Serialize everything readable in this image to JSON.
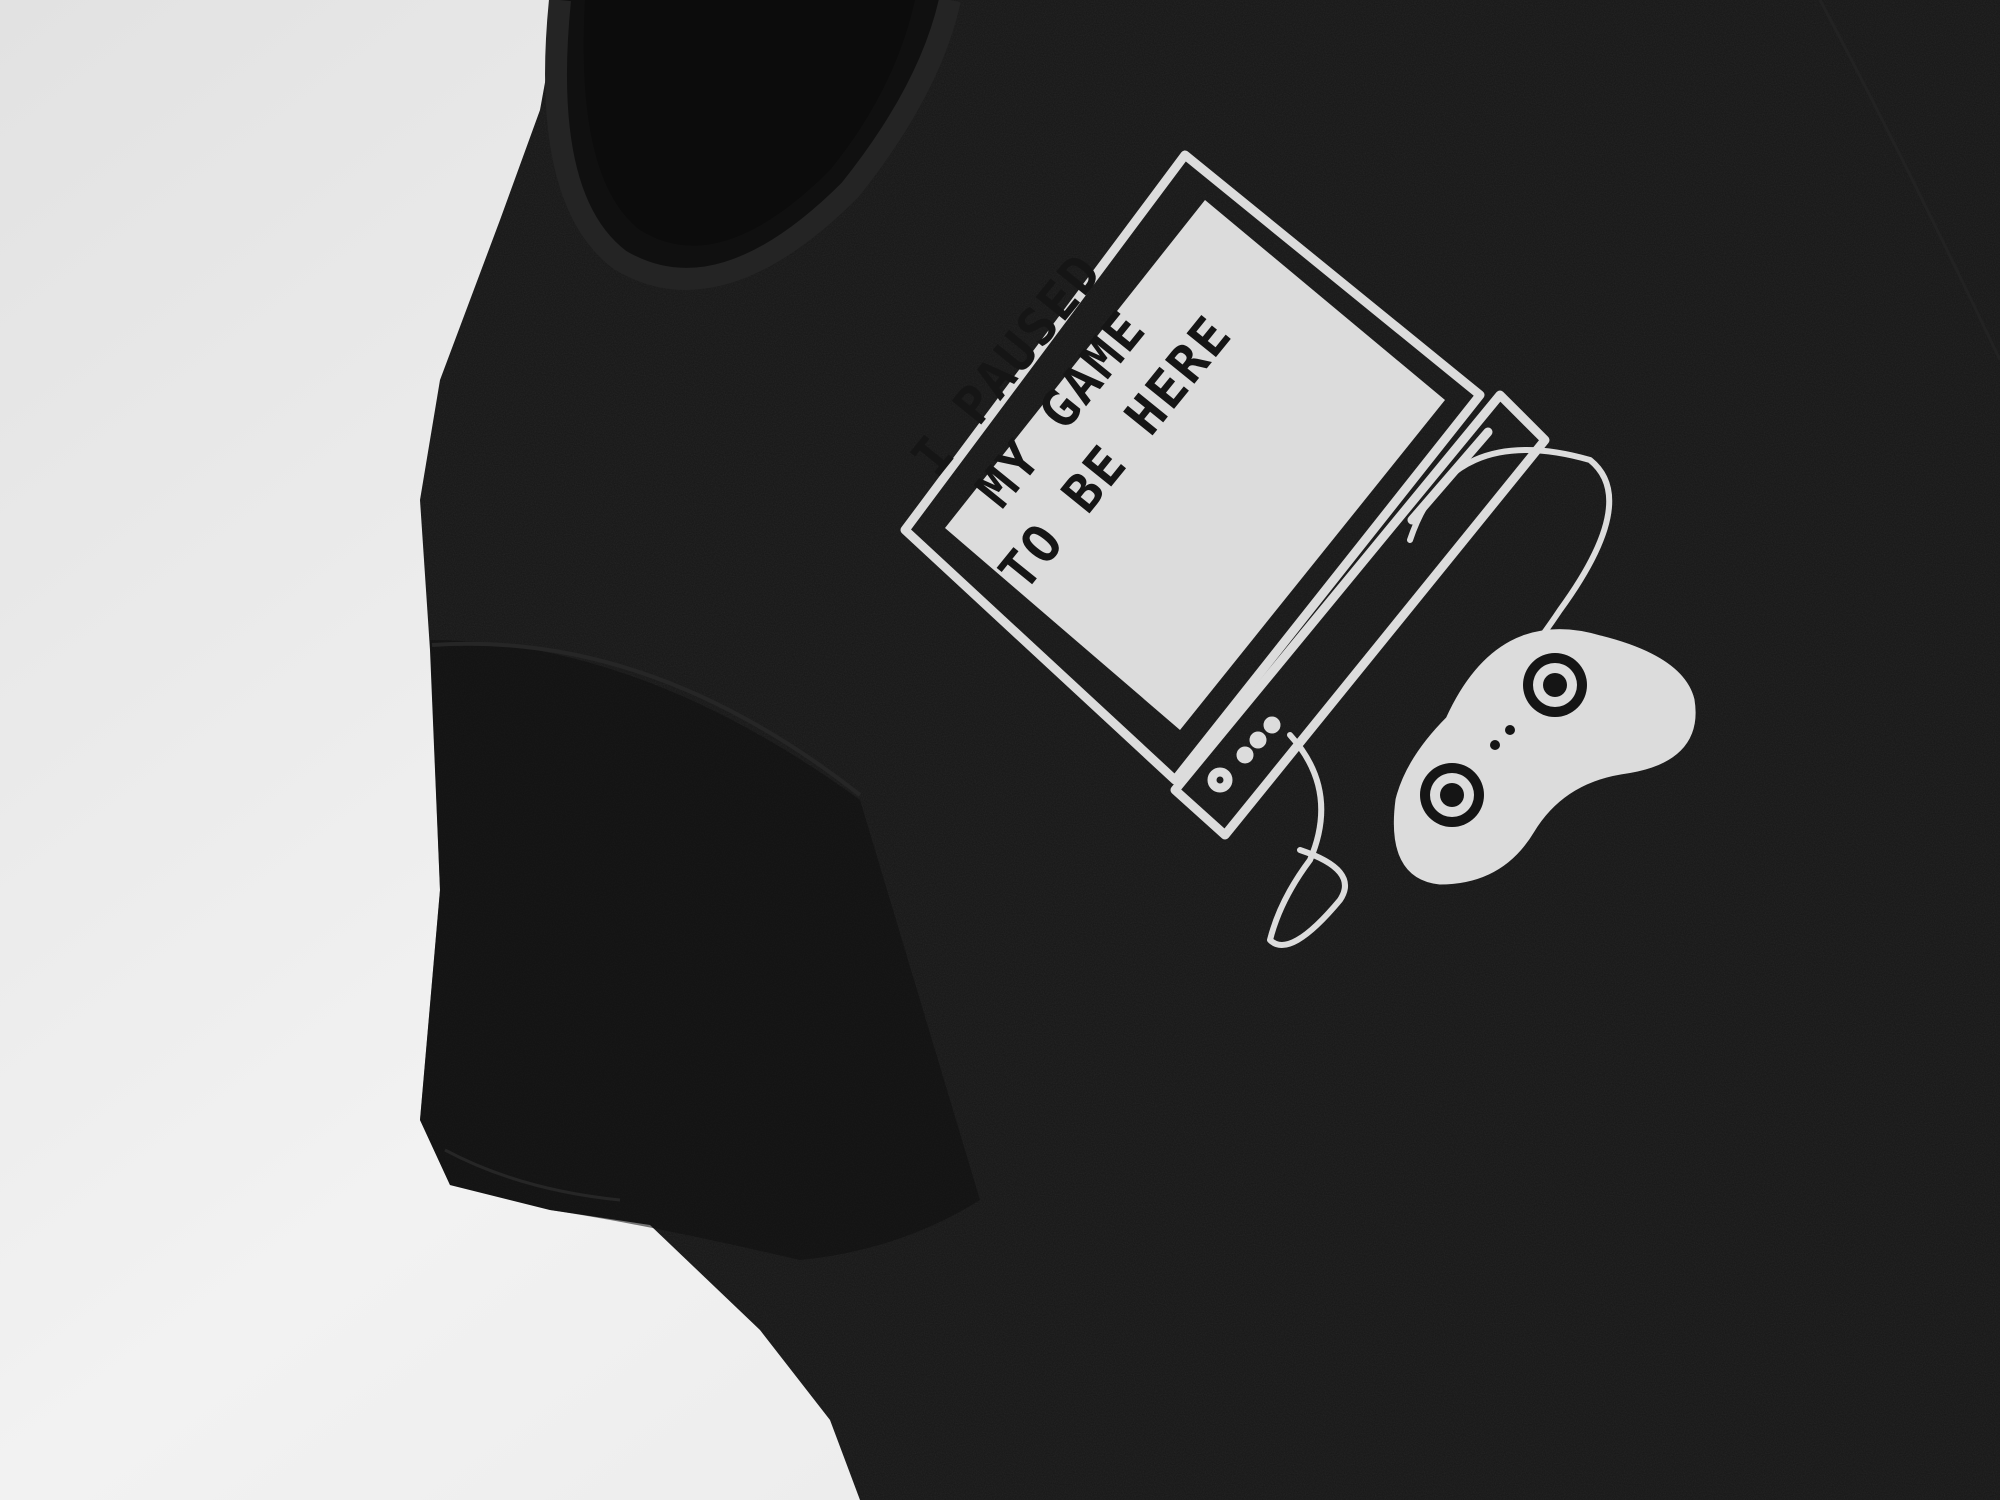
{
  "photo": {
    "subject": "black t-shirt flat lay",
    "background_color": "#ededed",
    "shirt_color": "#151515",
    "print_color": "#dcdcdc"
  },
  "print": {
    "lines": [
      "I PAUSED",
      "MY GAME",
      "TO BE HERE"
    ],
    "icons": [
      "tv-monitor-icon",
      "game-console-icon",
      "gamepad-controller-icon",
      "cable-icon"
    ]
  }
}
